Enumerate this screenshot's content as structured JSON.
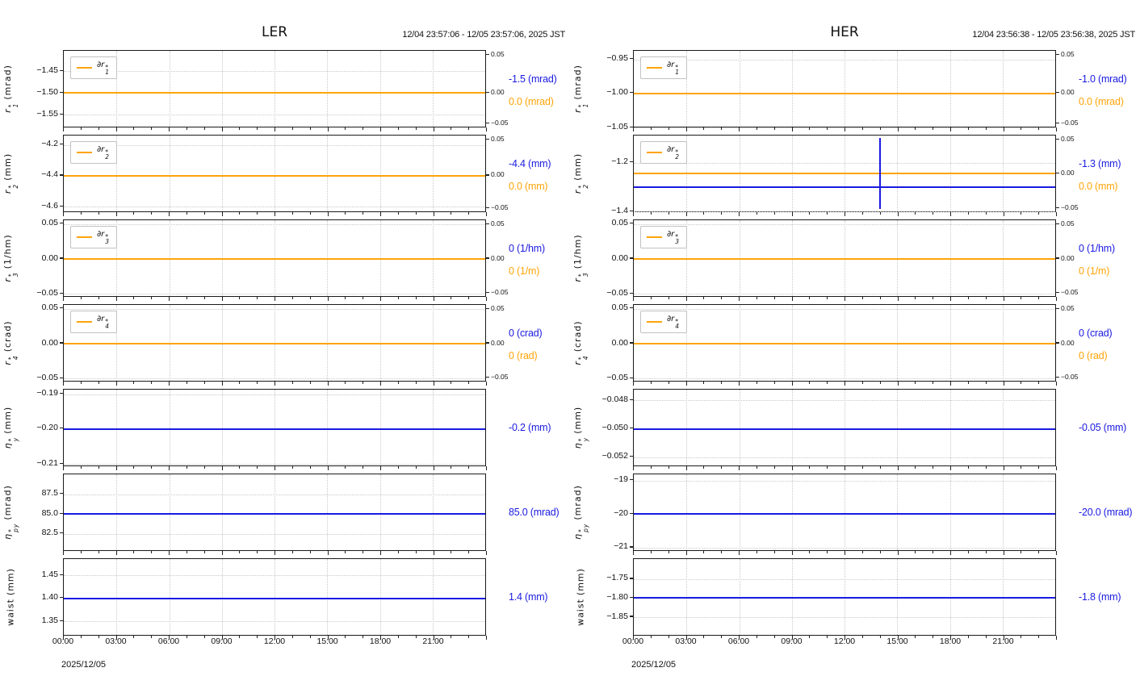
{
  "colors": {
    "blue": "#1a1ae0",
    "orange": "#ffa408"
  },
  "chart_data": [
    {
      "type": "line",
      "title": "LER",
      "time_range": "12/04 23:57:06 - 12/05 23:57:06, 2025 JST",
      "date_label": "2025/12/05",
      "x_axis": {
        "ticks": [
          "00:00",
          "03:00",
          "06:00",
          "09:00",
          "12:00",
          "15:00",
          "18:00",
          "21:00"
        ],
        "hours_span": 24,
        "minor_tick_hours": 1,
        "grid": "dotted"
      },
      "panels": [
        {
          "ylabel": {
            "base": "r",
            "sup": "*",
            "sub": "1",
            "unit": "(mrad)"
          },
          "legend": {
            "base": "∂r",
            "sup": "*",
            "sub": "1"
          },
          "ylim": [
            -1.581,
            -1.403
          ],
          "yticks": [
            {
              "v": -1.45,
              "label": "−1.45"
            },
            {
              "v": -1.5,
              "label": "−1.50"
            },
            {
              "v": -1.55,
              "label": "−1.55"
            }
          ],
          "series": [
            {
              "name": "value",
              "color": "blue",
              "value": -1.5
            },
            {
              "name": "delta",
              "color": "orange",
              "delta_value": 0.0,
              "plot_at": -1.5
            }
          ],
          "delta_ticks": [
            "0.05",
            "0.00",
            "−0.05"
          ],
          "readouts": [
            {
              "text": "-1.5 (mrad)",
              "color": "blue"
            },
            {
              "text": "0.0 (mrad)",
              "color": "orange"
            }
          ]
        },
        {
          "ylabel": {
            "base": "r",
            "sup": "*",
            "sub": "2",
            "unit": "(mm)"
          },
          "legend": {
            "base": "∂r",
            "sup": "*",
            "sub": "2"
          },
          "ylim": [
            -4.64,
            -4.14
          ],
          "yticks": [
            {
              "v": -4.2,
              "label": "−4.2"
            },
            {
              "v": -4.4,
              "label": "−4.4"
            },
            {
              "v": -4.6,
              "label": "−4.6"
            }
          ],
          "series": [
            {
              "name": "value",
              "color": "blue",
              "value": -4.4
            },
            {
              "name": "delta",
              "color": "orange",
              "delta_value": 0.0,
              "plot_at": -4.4
            }
          ],
          "delta_ticks": [
            "0.05",
            "0.00",
            "−0.05"
          ],
          "readouts": [
            {
              "text": "-4.4 (mm)",
              "color": "blue"
            },
            {
              "text": "0.0 (mm)",
              "color": "orange"
            }
          ]
        },
        {
          "ylabel": {
            "base": "r",
            "sup": "*",
            "sub": "3",
            "unit": "(1/hm)"
          },
          "legend": {
            "base": "∂r",
            "sup": "*",
            "sub": "3"
          },
          "ylim": [
            -0.0555,
            0.0555
          ],
          "yticks": [
            {
              "v": 0.05,
              "label": "0.05"
            },
            {
              "v": 0.0,
              "label": "0.00"
            },
            {
              "v": -0.05,
              "label": "−0.05"
            }
          ],
          "series": [
            {
              "name": "value",
              "color": "blue",
              "value": 0.0
            },
            {
              "name": "delta",
              "color": "orange",
              "delta_value": 0.0,
              "plot_at": 0.0
            }
          ],
          "delta_ticks": [
            "0.05",
            "0.00",
            "−0.05"
          ],
          "readouts": [
            {
              "text": "0 (1/hm)",
              "color": "blue"
            },
            {
              "text": "0 (1/m)",
              "color": "orange"
            }
          ]
        },
        {
          "ylabel": {
            "base": "r",
            "sup": "*",
            "sub": "4",
            "unit": "(crad)"
          },
          "legend": {
            "base": "∂r",
            "sup": "*",
            "sub": "4"
          },
          "ylim": [
            -0.0555,
            0.0555
          ],
          "yticks": [
            {
              "v": 0.05,
              "label": "0.05"
            },
            {
              "v": 0.0,
              "label": "0.00"
            },
            {
              "v": -0.05,
              "label": "−0.05"
            }
          ],
          "series": [
            {
              "name": "value",
              "color": "blue",
              "value": 0.0
            },
            {
              "name": "delta",
              "color": "orange",
              "delta_value": 0.0,
              "plot_at": 0.0
            }
          ],
          "delta_ticks": [
            "0.05",
            "0.00",
            "−0.05"
          ],
          "readouts": [
            {
              "text": "0 (crad)",
              "color": "blue"
            },
            {
              "text": "0 (rad)",
              "color": "orange"
            }
          ]
        },
        {
          "ylabel": {
            "base": "η",
            "sup": "*",
            "sub": "y",
            "unit": "(mm)"
          },
          "ylim": [
            -0.2109,
            -0.1887
          ],
          "yticks": [
            {
              "v": -0.19,
              "label": "−0.19"
            },
            {
              "v": -0.2,
              "label": "−0.20"
            },
            {
              "v": -0.21,
              "label": "−0.21"
            }
          ],
          "series": [
            {
              "name": "value",
              "color": "blue",
              "value": -0.2
            }
          ],
          "readouts": [
            {
              "text": "-0.2 (mm)",
              "color": "blue"
            }
          ]
        },
        {
          "ylabel": {
            "base": "η",
            "sup": "*",
            "sub": "py",
            "unit": "(mrad)"
          },
          "ylim": [
            80.2,
            90.05
          ],
          "yticks": [
            {
              "v": 87.5,
              "label": "87.5"
            },
            {
              "v": 85.0,
              "label": "85.0"
            },
            {
              "v": 82.5,
              "label": "82.5"
            }
          ],
          "series": [
            {
              "name": "value",
              "color": "blue",
              "value": 85.0
            }
          ],
          "readouts": [
            {
              "text": "85.0 (mrad)",
              "color": "blue"
            }
          ]
        },
        {
          "ylabel": {
            "base": "waist",
            "unit": "(mm)"
          },
          "ylim": [
            1.317,
            1.4855
          ],
          "yticks": [
            {
              "v": 1.45,
              "label": "1.45"
            },
            {
              "v": 1.4,
              "label": "1.40"
            },
            {
              "v": 1.35,
              "label": "1.35"
            }
          ],
          "series": [
            {
              "name": "value",
              "color": "blue",
              "value": 1.4
            }
          ],
          "readouts": [
            {
              "text": "1.4 (mm)",
              "color": "blue"
            }
          ]
        }
      ]
    },
    {
      "type": "line",
      "title": "HER",
      "time_range": "12/04 23:56:38 - 12/05 23:56:38, 2025 JST",
      "date_label": "2025/12/05",
      "x_axis": {
        "ticks": [
          "00:00",
          "03:00",
          "06:00",
          "09:00",
          "12:00",
          "15:00",
          "18:00",
          "21:00"
        ],
        "hours_span": 24,
        "minor_tick_hours": 1,
        "grid": "dotted"
      },
      "panels": [
        {
          "ylabel": {
            "base": "r",
            "sup": "*",
            "sub": "1",
            "unit": "(mrad)"
          },
          "legend": {
            "base": "∂r",
            "sup": "*",
            "sub": "1"
          },
          "ylim": [
            -1.051,
            -0.9375
          ],
          "yticks": [
            {
              "v": -0.95,
              "label": "−0.95"
            },
            {
              "v": -1.0,
              "label": "−1.00"
            },
            {
              "v": -1.05,
              "label": "−1.05"
            }
          ],
          "series": [
            {
              "name": "value",
              "color": "blue",
              "value": -1.0
            },
            {
              "name": "delta",
              "color": "orange",
              "delta_value": 0.0,
              "plot_at": -1.0
            }
          ],
          "delta_ticks": [
            "0.05",
            "0.00",
            "−0.05"
          ],
          "readouts": [
            {
              "text": "-1.0 (mrad)",
              "color": "blue"
            },
            {
              "text": "0.0 (mrad)",
              "color": "orange"
            }
          ]
        },
        {
          "ylabel": {
            "base": "r",
            "sup": "*",
            "sub": "2",
            "unit": "(mm)"
          },
          "legend": {
            "base": "∂r",
            "sup": "*",
            "sub": "2"
          },
          "ylim": [
            -1.406,
            -1.089
          ],
          "yticks": [
            {
              "v": -1.2,
              "label": "−1.2"
            },
            {
              "v": -1.4,
              "label": "−1.4"
            }
          ],
          "series": [
            {
              "name": "value",
              "color": "blue",
              "value": -1.3
            },
            {
              "name": "delta",
              "color": "orange",
              "delta_value": 0.0,
              "plot_at": -1.245
            }
          ],
          "spike": {
            "time": "14:00",
            "x_frac": 0.583,
            "y_top": 0.03,
            "y_bot": 0.97,
            "color": "blue"
          },
          "delta_ticks": [
            "0.05",
            "0.00",
            "−0.05"
          ],
          "readouts": [
            {
              "text": "-1.3 (mm)",
              "color": "blue"
            },
            {
              "text": "0.0 (mm)",
              "color": "orange"
            }
          ]
        },
        {
          "ylabel": {
            "base": "r",
            "sup": "*",
            "sub": "3",
            "unit": "(1/hm)"
          },
          "legend": {
            "base": "∂r",
            "sup": "*",
            "sub": "3"
          },
          "ylim": [
            -0.0555,
            0.0555
          ],
          "yticks": [
            {
              "v": 0.05,
              "label": "0.05"
            },
            {
              "v": 0.0,
              "label": "0.00"
            },
            {
              "v": -0.05,
              "label": "−0.05"
            }
          ],
          "series": [
            {
              "name": "value",
              "color": "blue",
              "value": 0.0
            },
            {
              "name": "delta",
              "color": "orange",
              "delta_value": 0.0,
              "plot_at": 0.0
            }
          ],
          "delta_ticks": [
            "0.05",
            "0.00",
            "−0.05"
          ],
          "readouts": [
            {
              "text": "0 (1/hm)",
              "color": "blue"
            },
            {
              "text": "0 (1/m)",
              "color": "orange"
            }
          ]
        },
        {
          "ylabel": {
            "base": "r",
            "sup": "*",
            "sub": "4",
            "unit": "(crad)"
          },
          "legend": {
            "base": "∂r",
            "sup": "*",
            "sub": "4"
          },
          "ylim": [
            -0.0555,
            0.0555
          ],
          "yticks": [
            {
              "v": 0.05,
              "label": "0.05"
            },
            {
              "v": 0.0,
              "label": "0.00"
            },
            {
              "v": -0.05,
              "label": "−0.05"
            }
          ],
          "series": [
            {
              "name": "value",
              "color": "blue",
              "value": 0.0
            },
            {
              "name": "delta",
              "color": "orange",
              "delta_value": 0.0,
              "plot_at": 0.0
            }
          ],
          "delta_ticks": [
            "0.05",
            "0.00",
            "−0.05"
          ],
          "readouts": [
            {
              "text": "0 (crad)",
              "color": "blue"
            },
            {
              "text": "0 (rad)",
              "color": "orange"
            }
          ]
        },
        {
          "ylabel": {
            "base": "η",
            "sup": "*",
            "sub": "y",
            "unit": "(mm)"
          },
          "ylim": [
            -0.0527,
            -0.04724
          ],
          "yticks": [
            {
              "v": -0.048,
              "label": "−0.048"
            },
            {
              "v": -0.05,
              "label": "−0.050"
            },
            {
              "v": -0.052,
              "label": "−0.052"
            }
          ],
          "series": [
            {
              "name": "value",
              "color": "blue",
              "value": -0.05
            }
          ],
          "readouts": [
            {
              "text": "-0.05 (mm)",
              "color": "blue"
            }
          ]
        },
        {
          "ylabel": {
            "base": "η",
            "sup": "*",
            "sub": "py",
            "unit": "(mrad)"
          },
          "ylim": [
            -21.12,
            -18.82
          ],
          "yticks": [
            {
              "v": -19,
              "label": "−19"
            },
            {
              "v": -20,
              "label": "−20"
            },
            {
              "v": -21,
              "label": "−21"
            }
          ],
          "series": [
            {
              "name": "value",
              "color": "blue",
              "value": -20.0
            }
          ],
          "readouts": [
            {
              "text": "-20.0 (mrad)",
              "color": "blue"
            }
          ]
        },
        {
          "ylabel": {
            "base": "waist",
            "unit": "(mm)"
          },
          "ylim": [
            -1.901,
            -1.697
          ],
          "yticks": [
            {
              "v": -1.75,
              "label": "−1.75"
            },
            {
              "v": -1.8,
              "label": "−1.80"
            },
            {
              "v": -1.85,
              "label": "−1.85"
            }
          ],
          "series": [
            {
              "name": "value",
              "color": "blue",
              "value": -1.8
            }
          ],
          "readouts": [
            {
              "text": "-1.8 (mm)",
              "color": "blue"
            }
          ]
        }
      ]
    }
  ]
}
